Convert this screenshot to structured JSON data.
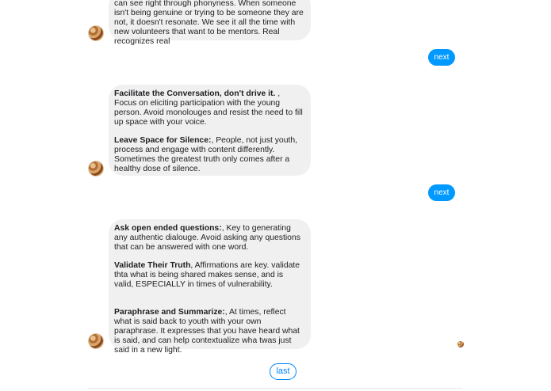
{
  "messages": [
    {
      "paragraphs": [
        {
          "bold": "",
          "text": "can see right through phonyness. When someone isn't being genuine or trying to be someone they are not, it doesn't resonate. We see it all the time with new volunteers that want to be mentors. Real recognizes real"
        }
      ]
    },
    {
      "paragraphs": [
        {
          "bold": "Facilitate the Conversation, don't drive it.",
          "text": " , Focus on eliciting participation with the young person. Avoid monolouges and resist the need to fill up space with your voice."
        },
        {
          "bold": "Leave Space for Silence:",
          "text": ", People, not just youth, process and engage with content differently. Sometimes the greatest truth only comes after a healthy dose of silence."
        }
      ]
    },
    {
      "paragraphs": [
        {
          "bold": "Ask open ended questions:",
          "text": ", Key to generating any authentic dialouge. Avoid asking any questions that can be answered with one word."
        },
        {
          "bold": "Validate Their Truth",
          "text": ", Affirmations are key. validate thta what is being shared makes sense, and is valid, ESPECIALLY in times of vulnerability."
        },
        {
          "bold": "Paraphrase and Summarize:",
          "text": ", At times, reflect what is said back to youth with your own paraphrase. It expresses that you have heard what is said, and can help contextualize wha twas just said in a new light."
        }
      ]
    }
  ],
  "quick_replies": {
    "next": "next",
    "last": "last"
  },
  "colors": {
    "bubble": "#f1f0f0",
    "accent": "#0099ff",
    "outline": "#0084ff"
  },
  "icons": {
    "avatar": "cookie-avatar-icon"
  }
}
